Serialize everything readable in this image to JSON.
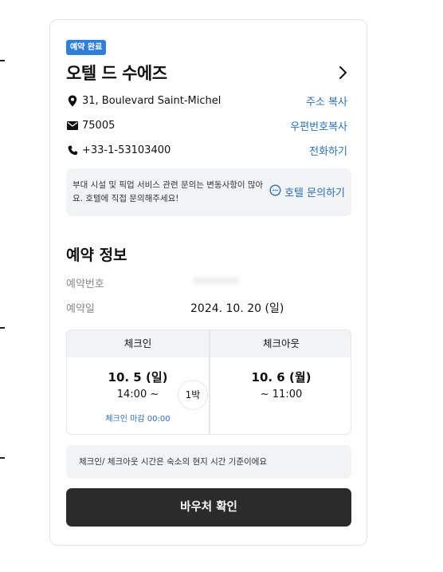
{
  "reservation": {
    "status_badge": "예약 완료",
    "hotel_name": "오텔 드 수에즈"
  },
  "contact": {
    "address": "31, Boulevard Saint-Michel",
    "address_action": "주소 복사",
    "postal_code": "75005",
    "postal_action": "우편번호복사",
    "phone": "+33-1-53103400",
    "phone_action": "전화하기"
  },
  "notice": {
    "message": "부대 시설 및 픽업 서비스 관련 문의는 변동사항이 많아요. 호텔에 직접 문의해주세요!",
    "inquiry_label": "호텔 문의하기"
  },
  "booking_info": {
    "title": "예약 정보",
    "number_label": "예약번호",
    "date_label": "예약일",
    "date_value": "2024. 10. 20 (일)"
  },
  "stay": {
    "checkin_label": "체크인",
    "checkin_date": "10. 5 (일)",
    "checkin_time": "14:00 ~",
    "checkin_deadline": "체크인 마감 00:00",
    "checkout_label": "체크아웃",
    "checkout_date": "10. 6 (월)",
    "checkout_time": "~ 11:00",
    "nights": "1박"
  },
  "timezone_note": "체크인/ 체크아웃 시간은 숙소의 현지 시간 기준이에요",
  "voucher_button": "바우처 확인",
  "colors": {
    "accent_blue": "#2a6fb5",
    "badge_blue": "#2f7fd8",
    "button_dark": "#2b2b2b",
    "panel_gray": "#f2f3f5"
  },
  "icons": [
    "location-pin-icon",
    "mail-icon",
    "phone-icon",
    "chat-icon",
    "chevron-right-icon"
  ]
}
